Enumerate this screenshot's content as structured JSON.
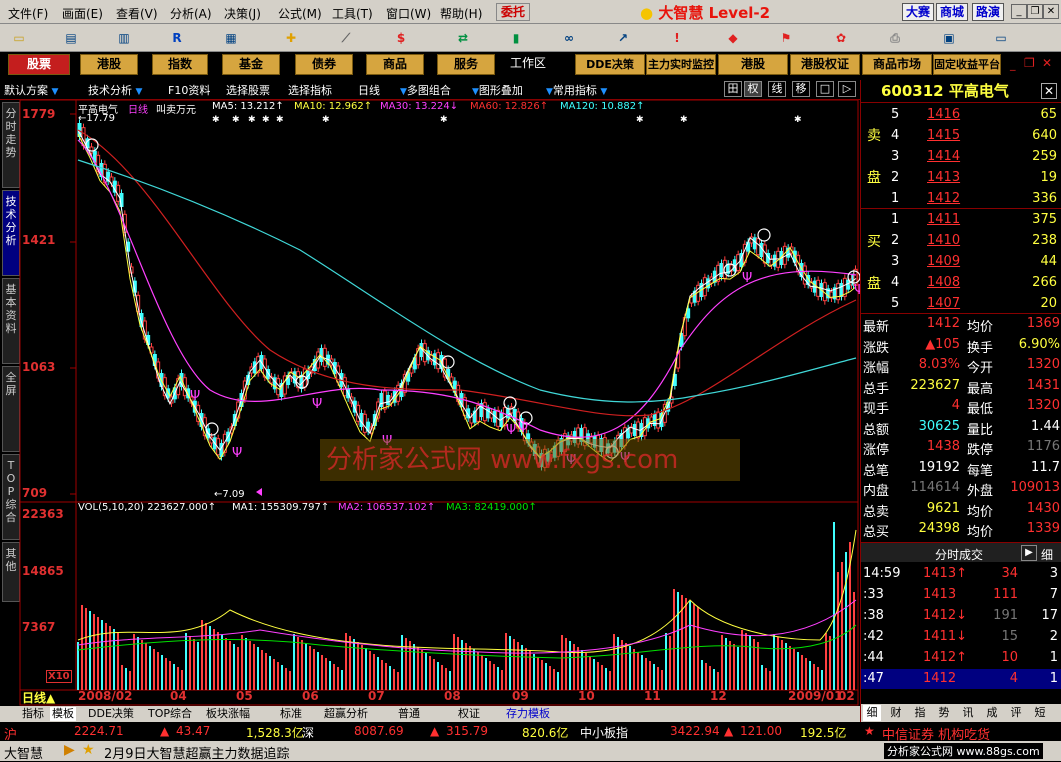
{
  "menu": {
    "items": [
      "文件(F)",
      "画面(E)",
      "查看(V)",
      "分析(A)",
      "决策(J)",
      "公式(M)",
      "工具(T)",
      "窗口(W)",
      "帮助(H)"
    ],
    "weituo": "委托",
    "brand": "大智慧",
    "level": "Level-2",
    "top_buttons": [
      "大赛",
      "商城",
      "路演"
    ]
  },
  "market_tabs": [
    "股票",
    "港股",
    "指数",
    "基金",
    "债券",
    "商品",
    "服务"
  ],
  "work_tabs": [
    "工作区",
    "DDE决策",
    "主力实时监控",
    "港股",
    "港股权证",
    "商品市场",
    "固定收益平台"
  ],
  "indicator_bar": {
    "items": [
      "默认方案",
      "技术分析",
      "F10资料",
      "选择股票",
      "选择指标",
      "日线",
      "多图组合",
      "图形叠加",
      "常用指标"
    ],
    "mode_icons": [
      "田",
      "权",
      "线",
      "移",
      "□",
      "▷"
    ]
  },
  "left_tabs": [
    "分时走势",
    "技术分析",
    "基本资料",
    "全屏",
    "TOP综合",
    "其他"
  ],
  "chart": {
    "title": "平高电气",
    "period": "日线",
    "subtitle": "叫卖万元",
    "ma_legend": [
      {
        "t": "MA5: 13.212↑",
        "c": "#ffffff"
      },
      {
        "t": "MA10: 12.962↑",
        "c": "#ffff40"
      },
      {
        "t": "MA30: 13.224↓",
        "c": "#ff40ff"
      },
      {
        "t": "MA60: 12.826↑",
        "c": "#ff3030"
      },
      {
        "t": "MA120: 10.882↑",
        "c": "#40ffff"
      }
    ],
    "y_labels": [
      "1779",
      "1421",
      "1063",
      "709"
    ],
    "high_note": "←17.79",
    "low_note": "←7.09",
    "vol_legend": [
      {
        "t": "VOL(5,10,20) 223627.000↑",
        "c": "#ffffff"
      },
      {
        "t": "MA1: 155309.797↑",
        "c": "#ffffff"
      },
      {
        "t": "MA2: 106537.102↑",
        "c": "#ff40ff"
      },
      {
        "t": "MA3: 82419.000↑",
        "c": "#00e000"
      }
    ],
    "vol_labels": [
      "22363",
      "14865",
      "7367"
    ],
    "vol_unit": "X10",
    "x_labels": [
      "2008/02",
      "04",
      "05",
      "06",
      "07",
      "08",
      "09",
      "10",
      "11",
      "12",
      "2009/01",
      "02"
    ],
    "period_label": "日线▲",
    "watermark": "分析家公式网 www.fxgs.com"
  },
  "bottom_tabs": [
    "指标",
    "模板",
    "DDE决策",
    "TOP综合",
    "板块涨幅",
    "标准",
    "超赢分析",
    "普通",
    "权证",
    "存力模板"
  ],
  "ticker": {
    "sh_label": "沪",
    "sh_val": "2224.71",
    "sh_chg": "43.47",
    "sh_amt": "1,528.3亿",
    "sz_label": "深",
    "sz_val": "8087.69",
    "sz_chg": "315.79",
    "sz_amt": "820.6亿",
    "zx_label": "中小板指",
    "zx_val": "3422.94",
    "zx_chg": "121.00",
    "zx_amt": "192.5亿",
    "news": "中信证券 机构吃货"
  },
  "status": {
    "app": "大智慧",
    "msg": "2月9日大智慧超赢主力数据追踪",
    "site": "分析家公式网 www.88gs.com"
  },
  "quote": {
    "code": "600312",
    "name": "平高电气",
    "sell": [
      {
        "n": "5",
        "p": "1416",
        "v": "65"
      },
      {
        "n": "4",
        "p": "1415",
        "v": "640"
      },
      {
        "n": "3",
        "p": "1414",
        "v": "259"
      },
      {
        "n": "2",
        "p": "1413",
        "v": "19"
      },
      {
        "n": "1",
        "p": "1412",
        "v": "336"
      }
    ],
    "buy": [
      {
        "n": "1",
        "p": "1411",
        "v": "375"
      },
      {
        "n": "2",
        "p": "1410",
        "v": "238"
      },
      {
        "n": "3",
        "p": "1409",
        "v": "44"
      },
      {
        "n": "4",
        "p": "1408",
        "v": "266"
      },
      {
        "n": "5",
        "p": "1407",
        "v": "20"
      }
    ],
    "sell_label": [
      "卖",
      "盘"
    ],
    "buy_label": [
      "买",
      "盘"
    ],
    "stats": [
      {
        "l1": "最新",
        "v1": "1412",
        "c1": "red",
        "l2": "均价",
        "v2": "1369",
        "c2": "red"
      },
      {
        "l1": "涨跌",
        "v1": "▲105",
        "c1": "red",
        "l2": "换手",
        "v2": "6.90%",
        "c2": "yel"
      },
      {
        "l1": "涨幅",
        "v1": "8.03%",
        "c1": "red",
        "l2": "今开",
        "v2": "1320",
        "c2": "red"
      },
      {
        "l1": "总手",
        "v1": "223627",
        "c1": "yel",
        "l2": "最高",
        "v2": "1431",
        "c2": "red"
      },
      {
        "l1": "现手",
        "v1": "4",
        "c1": "red",
        "l2": "最低",
        "v2": "1320",
        "c2": "red"
      },
      {
        "l1": "总额",
        "v1": "30625",
        "c1": "cyn",
        "l2": "量比",
        "v2": "1.44",
        "c2": "wht"
      },
      {
        "l1": "涨停",
        "v1": "1438",
        "c1": "red",
        "l2": "跌停",
        "v2": "1176",
        "c2": "gry"
      },
      {
        "l1": "总笔",
        "v1": "19192",
        "c1": "wht",
        "l2": "每笔",
        "v2": "11.7",
        "c2": "wht"
      },
      {
        "l1": "内盘",
        "v1": "114614",
        "c1": "gry",
        "l2": "外盘",
        "v2": "109013",
        "c2": "red"
      },
      {
        "l1": "总卖",
        "v1": "9621",
        "c1": "yel",
        "l2": "均价",
        "v2": "1430",
        "c2": "red"
      },
      {
        "l1": "总买",
        "v1": "24398",
        "c1": "yel",
        "l2": "均价",
        "v2": "1339",
        "c2": "red"
      }
    ],
    "ticks_title": "分时成交",
    "ticks_btn": "细",
    "ticks": [
      {
        "t": "14:59",
        "p": "1413↑",
        "v": "34",
        "n": "3",
        "vc": "red"
      },
      {
        "t": ":33",
        "p": "1413",
        "v": "111",
        "n": "7",
        "vc": "red"
      },
      {
        "t": ":38",
        "p": "1412↓",
        "v": "191",
        "n": "17",
        "vc": "gry"
      },
      {
        "t": ":42",
        "p": "1411↓",
        "v": "15",
        "n": "2",
        "vc": "gry"
      },
      {
        "t": ":44",
        "p": "1412↑",
        "v": "10",
        "n": "1",
        "vc": "red"
      },
      {
        "t": ":47",
        "p": "1412",
        "v": "4",
        "n": "1",
        "vc": "red"
      }
    ],
    "bottom_tabs": [
      "细",
      "财",
      "指",
      "势",
      "讯",
      "成",
      "评",
      "短"
    ]
  }
}
